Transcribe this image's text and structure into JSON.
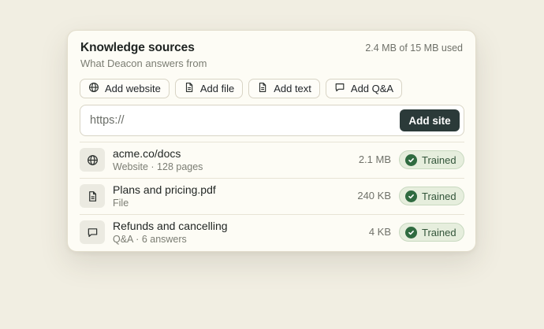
{
  "header": {
    "title": "Knowledge sources",
    "subtitle": "What Deacon answers from",
    "usage": "2.4 MB of 15 MB used"
  },
  "toolbar": {
    "buttons": [
      {
        "label": "Add website",
        "icon": "globe-icon"
      },
      {
        "label": "Add file",
        "icon": "file-icon"
      },
      {
        "label": "Add text",
        "icon": "text-doc-icon"
      },
      {
        "label": "Add Q&A",
        "icon": "chat-bubble-icon"
      }
    ]
  },
  "url_input": {
    "placeholder": "https://",
    "value": ""
  },
  "add_site_label": "Add site",
  "sources": [
    {
      "name": "acme.co/docs",
      "meta": "Website · 128 pages",
      "size": "2.1 MB",
      "status": "Trained",
      "icon": "globe-icon"
    },
    {
      "name": "Plans and pricing.pdf",
      "meta": "File",
      "size": "240 KB",
      "status": "Trained",
      "icon": "file-icon"
    },
    {
      "name": "Refunds and cancelling",
      "meta": "Q&A · 6 answers",
      "size": "4 KB",
      "status": "Trained",
      "icon": "chat-bubble-icon"
    }
  ],
  "colors": {
    "background": "#f1eee2",
    "card": "#fdfcf5",
    "primary_button": "#2b3a39",
    "trained_badge": "#e6eedd",
    "trained_check": "#2f6b40"
  }
}
